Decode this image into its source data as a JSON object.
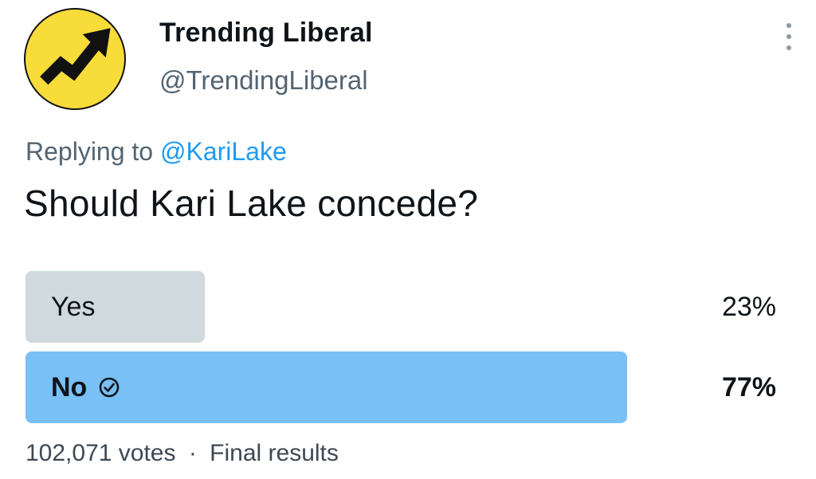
{
  "author": {
    "display_name": "Trending Liberal",
    "handle": "@TrendingLiberal",
    "avatar_icon": "trending-arrow-icon",
    "avatar_bg": "#f7dc3a"
  },
  "reply": {
    "prefix": "Replying to",
    "mention": "@KariLake"
  },
  "question": "Should Kari Lake concede?",
  "poll": {
    "options": [
      {
        "label": "Yes",
        "percent_text": "23%",
        "fraction": 0.23,
        "winner": false,
        "color": "#cfd9de"
      },
      {
        "label": "No",
        "percent_text": "77%",
        "fraction": 0.77,
        "winner": true,
        "color": "#78c0f5"
      }
    ],
    "check_icon": "check-circle-icon"
  },
  "footer": {
    "votes": "102,071 votes",
    "separator": "·",
    "status": "Final results"
  },
  "more_icon": "more-vertical-icon"
}
